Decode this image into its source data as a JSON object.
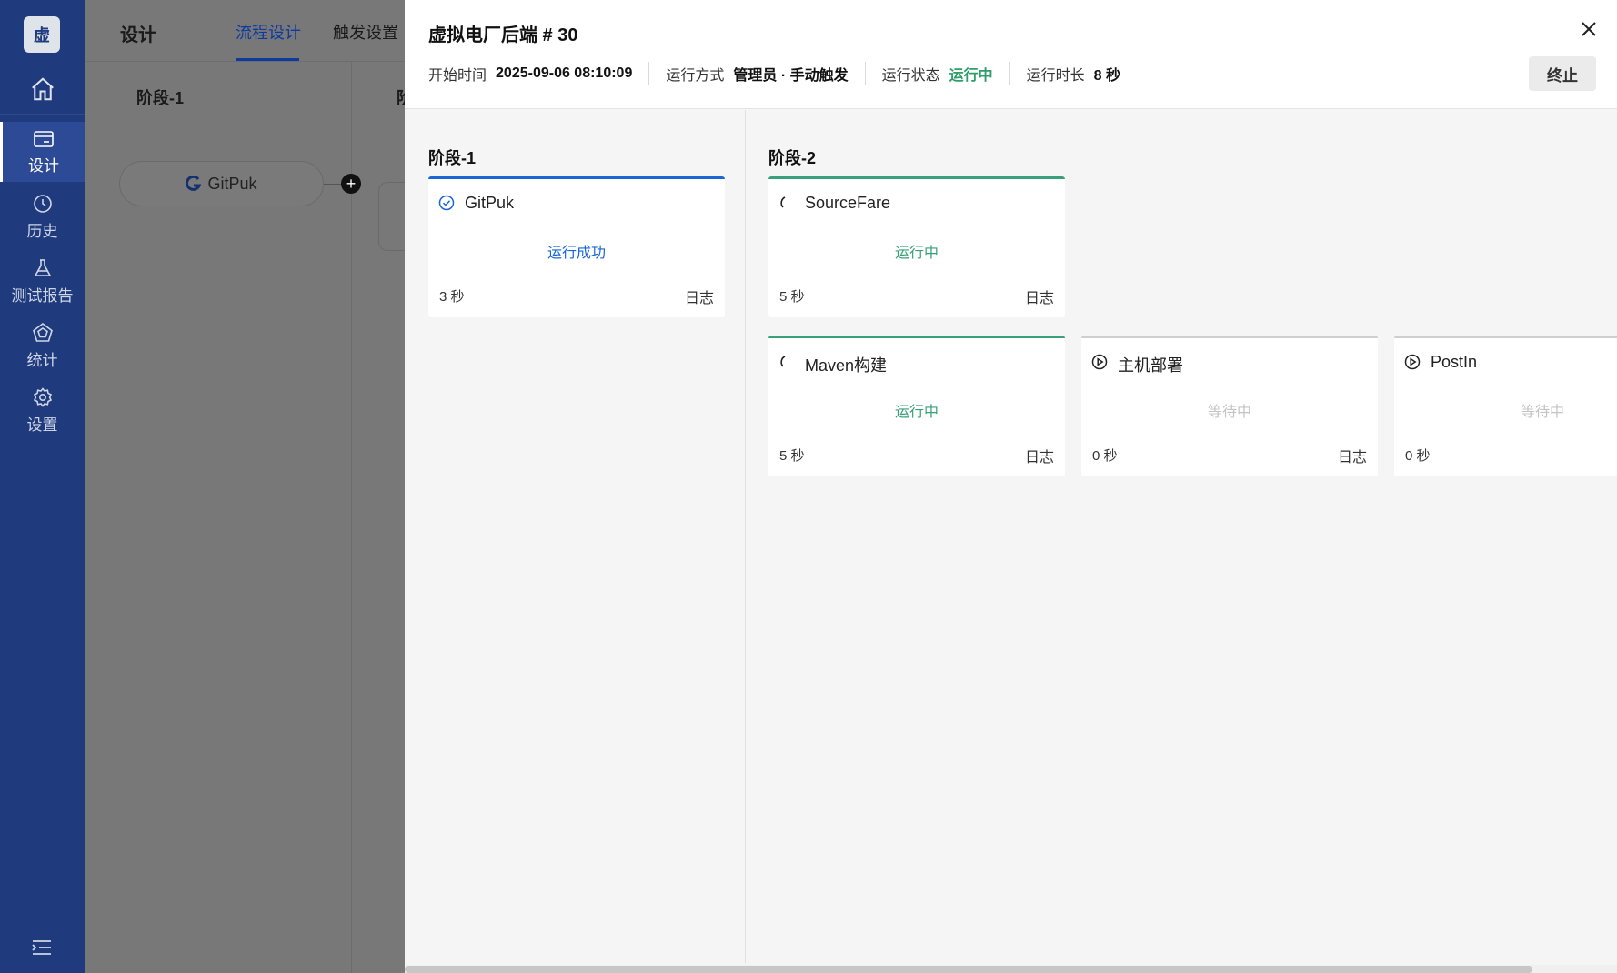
{
  "sidebar": {
    "logo": "虚",
    "items": [
      {
        "label": "设计",
        "icon": "design-icon"
      },
      {
        "label": "历史",
        "icon": "history-clock-icon"
      },
      {
        "label": "测试报告",
        "icon": "flask-icon"
      },
      {
        "label": "统计",
        "icon": "statistics-icon"
      },
      {
        "label": "设置",
        "icon": "gear-icon"
      }
    ]
  },
  "background": {
    "title": "设计",
    "tabs": [
      "流程设计",
      "触发设置"
    ],
    "stage1": "阶段-1",
    "stage2_partial": "阶",
    "node": "GitPuk"
  },
  "drawer": {
    "title": "虚拟电厂后端 # 30",
    "start_label": "开始时间",
    "start_value": "2025-09-06 08:10:09",
    "mode_label": "运行方式",
    "mode_value": "管理员 · 手动触发",
    "state_label": "运行状态",
    "state_value": "运行中",
    "duration_label": "运行时长",
    "duration_value": "8 秒",
    "stop_label": "终止",
    "stages": [
      {
        "title": "阶段-1",
        "tasks": [
          {
            "name": "GitPuk",
            "status": "运行成功",
            "time": "3 秒",
            "log": "日志"
          }
        ]
      },
      {
        "title": "阶段-2",
        "tasks": [
          {
            "name": "SourceFare",
            "status": "运行中",
            "time": "5 秒",
            "log": "日志"
          },
          {
            "name": "Maven构建",
            "status": "运行中",
            "time": "5 秒",
            "log": "日志"
          },
          {
            "name": "主机部署",
            "status": "等待中",
            "time": "0 秒",
            "log": "日志"
          },
          {
            "name": "PostIn",
            "status": "等待中",
            "time": "0 秒",
            "log": ""
          }
        ]
      }
    ]
  },
  "colors": {
    "sidebar": "#1f3a7d",
    "success_blue": "#1a66d9",
    "running_green": "#3aa07a",
    "waiting_gray": "#c4c4c4"
  }
}
